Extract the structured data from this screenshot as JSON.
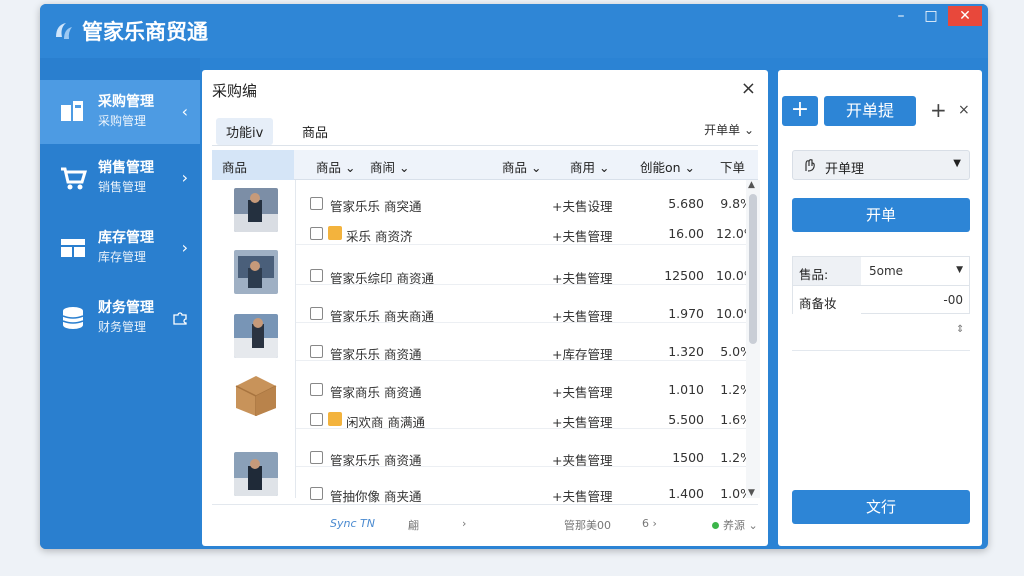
{
  "app": {
    "title": "管家乐商贸通"
  },
  "window_controls": {
    "minimize": "–",
    "maximize": "□",
    "close": "✕"
  },
  "sidebar": {
    "items": [
      {
        "label": "采购管理",
        "sub": "采购管理",
        "active": true,
        "chevron": "‹"
      },
      {
        "label": "销售管理",
        "sub": "销售管理",
        "active": false,
        "chevron": "›"
      },
      {
        "label": "库存管理",
        "sub": "库存管理",
        "active": false,
        "chevron": "›"
      },
      {
        "label": "财务管理",
        "sub": "财务管理",
        "active": false,
        "chevron": ""
      }
    ]
  },
  "panel": {
    "title": "采购编",
    "close": "×",
    "tabs": [
      "功能iv",
      "商品"
    ],
    "tab_right": "开单单 ⌄",
    "headers": {
      "first": "商品",
      "c1": "商品 ⌄",
      "c2": "商闹 ⌄",
      "c3": "商品 ⌄",
      "c4": "商用 ⌄",
      "c5": "创能on ⌄",
      "c6": "下单"
    },
    "rows": [
      {
        "name": "管家乐乐 商突通",
        "cat": "+夫售设理",
        "num": "5.680",
        "pct": "9.8%",
        "indent": false
      },
      {
        "name": "采乐 商资济",
        "cat": "+夫售管理",
        "num": "16.00",
        "pct": "12.0%",
        "indent": true
      },
      {
        "name": "管家乐综印 商资通",
        "cat": "+夫售管理",
        "num": "12500",
        "pct": "10.0%",
        "indent": false
      },
      {
        "name": "管家乐乐 商夹商通",
        "cat": "+夫售管理",
        "num": "1.970",
        "pct": "10.0%",
        "indent": false
      },
      {
        "name": "管家乐乐 商资通",
        "cat": "+库存管理",
        "num": "1.320",
        "pct": "5.0%",
        "indent": false
      },
      {
        "name": "管家商乐 商资通",
        "cat": "+夫售管理",
        "num": "1.010",
        "pct": "1.2%",
        "indent": false
      },
      {
        "name": "闲欢商 商满通",
        "cat": "+夫售管理",
        "num": "5.500",
        "pct": "1.6%",
        "indent": true
      },
      {
        "name": "管家乐乐 商资通",
        "cat": "+夹售管理",
        "num": "1500",
        "pct": "1.2%",
        "indent": false
      },
      {
        "name": "管抽你像 商夹通",
        "cat": "+夫售管理",
        "num": "1.400",
        "pct": "1.0%",
        "indent": false
      }
    ],
    "footer": {
      "logo_text": "Sync TN",
      "f2": "翩",
      "f3": "›",
      "f4": "管那美00",
      "f5": "6 ›",
      "status": "养源 ⌄"
    }
  },
  "right": {
    "plus": "+",
    "open_tab": "开单提",
    "add": "+",
    "close": "×",
    "select_label": "开单理",
    "open_button": "开单",
    "form": {
      "l1": "售品:",
      "v1": "5ome",
      "l2": "商备妆",
      "v2": "-00"
    },
    "spinner": "⇕",
    "submit_button": "文行"
  },
  "colors": {
    "brand_blue": "#2b83d4",
    "active_nav": "#4d9be3",
    "button_blue": "#2d85d6",
    "status_green": "#3bb54a"
  }
}
